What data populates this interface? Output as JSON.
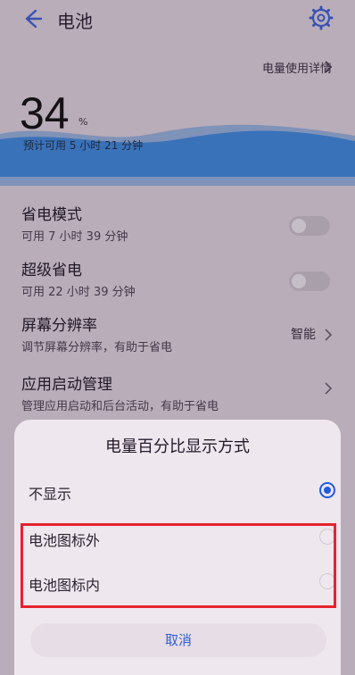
{
  "header": {
    "title": "电池",
    "back_icon": "arrow-left-icon",
    "settings_icon": "gear-icon"
  },
  "usage_link": "电量使用详情",
  "battery": {
    "percent_value": "34",
    "percent_sign": "%",
    "estimate": "预计可用 5 小时 21 分钟",
    "wave_color": "#3f86d8"
  },
  "rows": [
    {
      "title": "省电模式",
      "subtitle": "可用 7 小时 39 分钟",
      "toggle_on": false
    },
    {
      "title": "超级省电",
      "subtitle": "可用 22 小时 39 分钟",
      "toggle_on": false
    },
    {
      "title": "屏幕分辨率",
      "subtitle": "调节屏幕分辨率，有助于省电",
      "value": "智能"
    },
    {
      "title": "应用启动管理",
      "subtitle": "管理应用启动和后台活动，有助于省电"
    }
  ],
  "dialog": {
    "title": "电量百分比显示方式",
    "options": [
      {
        "label": "不显示",
        "selected": true
      },
      {
        "label": "电池图标外",
        "selected": false
      },
      {
        "label": "电池图标内",
        "selected": false
      }
    ],
    "cancel": "取消",
    "accent": "#1f5be0",
    "highlight_color": "#e5232f"
  }
}
